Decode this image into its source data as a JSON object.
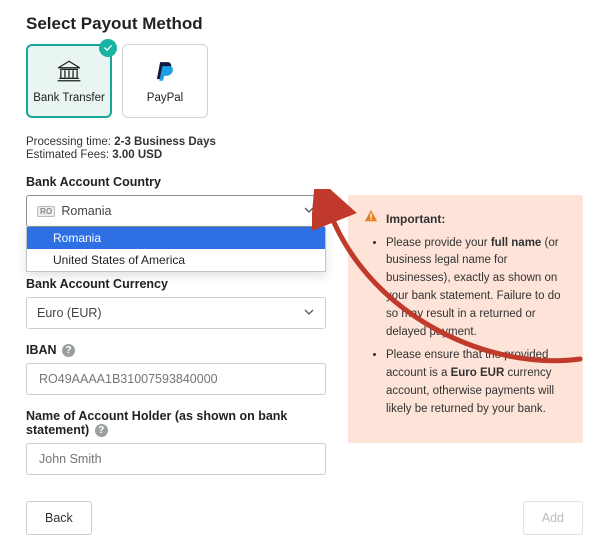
{
  "title": "Select Payout Method",
  "methods": {
    "bank": {
      "label": "Bank Transfer"
    },
    "paypal": {
      "label": "PayPal"
    }
  },
  "meta": {
    "processing_key": "Processing time:",
    "processing_val": "2-3 Business Days",
    "fees_key": "Estimated Fees:",
    "fees_val": "3.00 USD"
  },
  "labels": {
    "country": "Bank Account Country",
    "currency": "Bank Account Currency",
    "iban": "IBAN",
    "holder": "Name of Account Holder (as shown on bank statement)"
  },
  "country_select": {
    "flag": "RO",
    "value": "Romania",
    "options": [
      "Romania",
      "United States of America"
    ]
  },
  "currency_select": {
    "value": "Euro (EUR)"
  },
  "iban": {
    "placeholder": "RO49AAAA1B31007593840000"
  },
  "holder": {
    "placeholder": "John Smith"
  },
  "alert": {
    "title": "Important:",
    "lines": [
      "Please provide your <b>full name</b> (or business legal name for businesses), exactly as shown on your bank statement. Failure to do so may result in a returned or delayed payment.",
      "Please ensure that the provided account is a <b>Euro EUR</b> currency account, otherwise payments will likely be returned by your bank."
    ]
  },
  "buttons": {
    "back": "Back",
    "add": "Add"
  },
  "colors": {
    "teal": "#17b3a3",
    "alert_bg": "#fde3d8",
    "highlight": "#2f6fe4",
    "arrow": "#c0392b"
  }
}
